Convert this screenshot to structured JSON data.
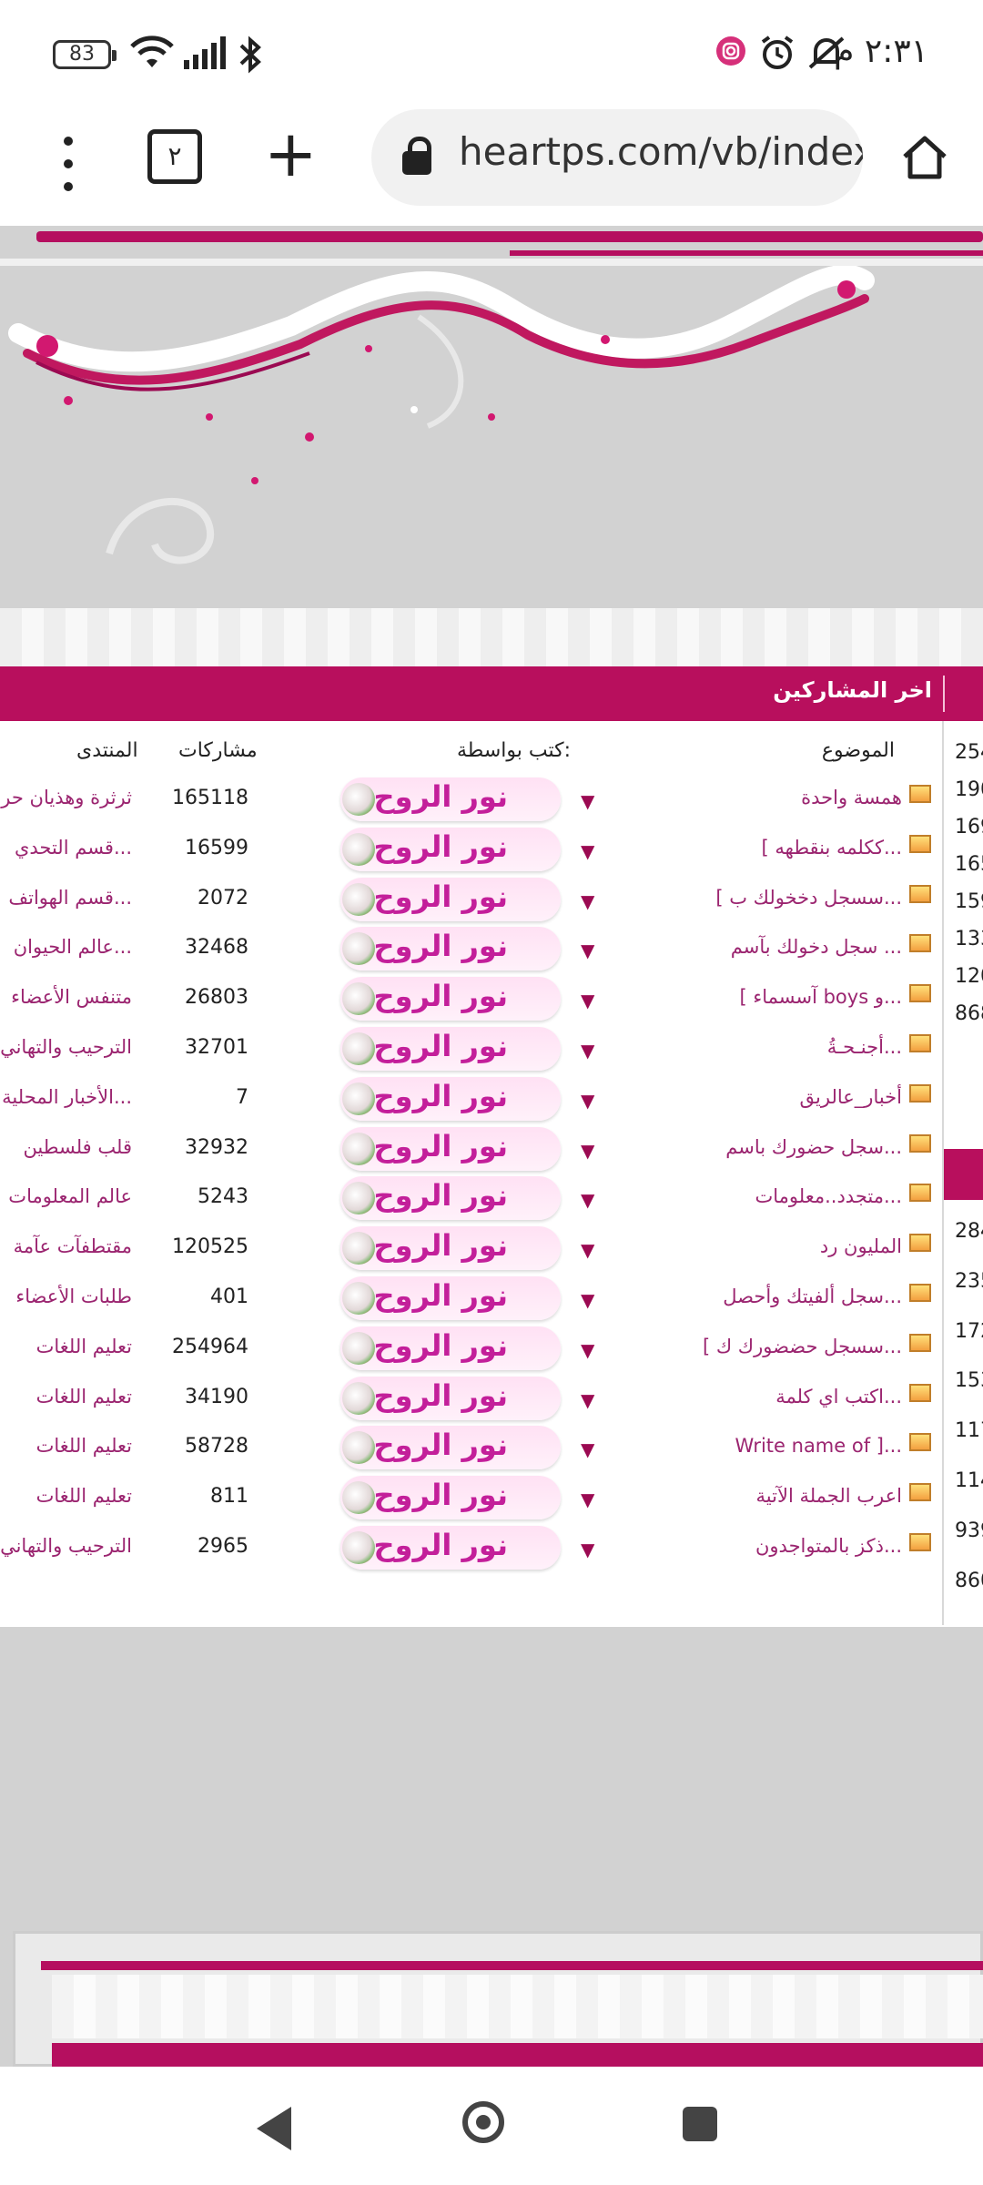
{
  "status_bar": {
    "time": "٢:٣١ م",
    "battery": "83"
  },
  "browser": {
    "url": "heartps.com/vb/index",
    "tab_count": "٢"
  },
  "section": {
    "title": "اخر المشاركين"
  },
  "columns": {
    "topic": "الموضوع",
    "author": "كتب بواسطة:",
    "posts": "مشاركات",
    "forum": "المنتدى"
  },
  "rows": [
    {
      "topic": "همسة واحدة",
      "author": "نور الروح",
      "posts": "165118",
      "forum": "ثرثرة وهذيان حر"
    },
    {
      "topic": "[ ككلمه بنقطهه...",
      "author": "نور الروح",
      "posts": "16599",
      "forum": "قسم التحدي..."
    },
    {
      "topic": "[ سسجل دخخولك ب...",
      "author": "نور الروح",
      "posts": "2072",
      "forum": "قسم الهواتف..."
    },
    {
      "topic": "سجل دخولك بآسم ...",
      "author": "نور الروح",
      "posts": "32468",
      "forum": "عالم الحيوان..."
    },
    {
      "topic": "[ آسسماء boys و...",
      "author": "نور الروح",
      "posts": "26803",
      "forum": "متنفس الأعضاء"
    },
    {
      "topic": "أجنـحـةُ...",
      "author": "نور الروح",
      "posts": "32701",
      "forum": "الترحيب والتهاني"
    },
    {
      "topic": "أخبار_عالريق",
      "author": "نور الروح",
      "posts": "7",
      "forum": "الأخبار المحلية..."
    },
    {
      "topic": "سجل حضورك باسم...",
      "author": "نور الروح",
      "posts": "32932",
      "forum": "قلب فلسطين"
    },
    {
      "topic": "متجدد..معلومات...",
      "author": "نور الروح",
      "posts": "5243",
      "forum": "عالم المعلومات"
    },
    {
      "topic": "المليون رد",
      "author": "نور الروح",
      "posts": "120525",
      "forum": "مقتطفآت عآمة"
    },
    {
      "topic": "سجل ألفيتك وأحصل...",
      "author": "نور الروح",
      "posts": "401",
      "forum": "طلبات الأعضاء"
    },
    {
      "topic": "[ سسجل حضضورك ك...",
      "author": "نور الروح",
      "posts": "254964",
      "forum": "تعليم اللغات"
    },
    {
      "topic": "اكتب اي كلمة...",
      "author": "نور الروح",
      "posts": "34190",
      "forum": "تعليم اللغات"
    },
    {
      "topic": "Write name of ]...",
      "author": "نور الروح",
      "posts": "58728",
      "forum": "تعليم اللغات"
    },
    {
      "topic": "اعرب الجملة الآتية",
      "author": "نور الروح",
      "posts": "811",
      "forum": "تعليم اللغات"
    },
    {
      "topic": "ذكز بالمتواجدون...",
      "author": "نور الروح",
      "posts": "2965",
      "forum": "الترحيب والتهاني"
    }
  ],
  "side_numbers_top": [
    "254",
    "190",
    "169",
    "165",
    "159",
    "133",
    "120",
    "868"
  ],
  "side_numbers_bottom": [
    "284",
    "235",
    "172",
    "153",
    "117",
    "114",
    "939",
    "860"
  ],
  "colors": {
    "brand": "#b80f5d",
    "link": "#9b2570",
    "author_text": "#c31f9a"
  }
}
